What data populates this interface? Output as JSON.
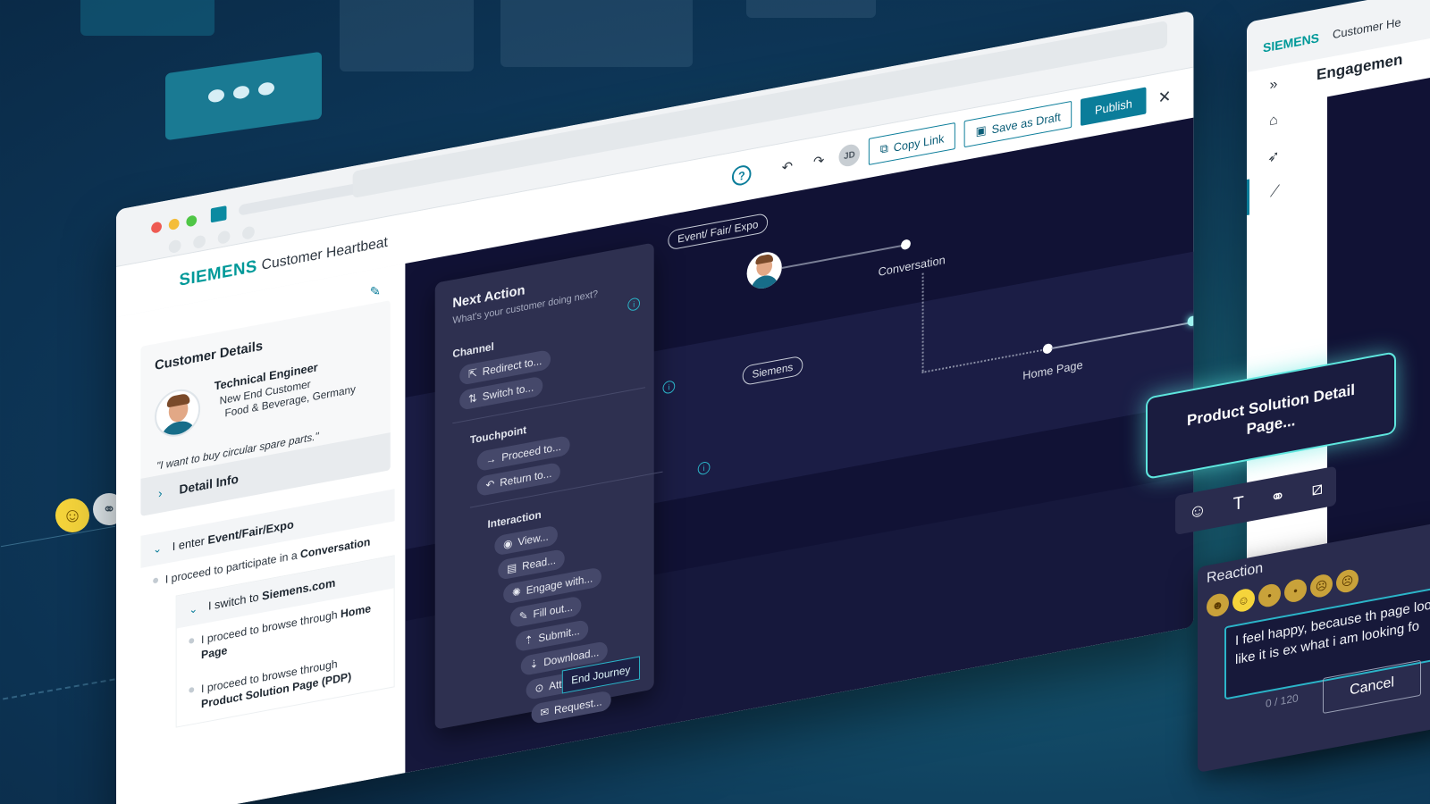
{
  "app": {
    "logo": "SIEMENS",
    "title": "Customer Heartbeat"
  },
  "header": {
    "user_initials": "JD",
    "copy_link": "Copy Link",
    "save_draft": "Save as Draft",
    "publish": "Publish"
  },
  "customer": {
    "section_title": "Customer Details",
    "role": "Technical Engineer",
    "segment": "New End Customer",
    "industry": "Food & Beverage, Germany",
    "quote": "\"I want to buy circular spare parts.\"",
    "detail_info": "Detail Info"
  },
  "journey_steps": {
    "step1_header_prefix": "I enter ",
    "step1_header_bold": "Event/Fair/Expo",
    "step1_item_prefix": "I proceed to participate in a ",
    "step1_item_bold": "Conversation",
    "step2_header_prefix": "I switch to ",
    "step2_header_bold": "Siemens.com",
    "step2_item1_prefix": "I proceed to browse through ",
    "step2_item1_bold": "Home Page",
    "step2_item2_prefix": "I proceed to browse through ",
    "step2_item2_bold": "Product Solution Page (PDP)"
  },
  "next_action": {
    "title": "Next Action",
    "subtitle": "What's your customer doing next?",
    "channel_label": "Channel",
    "channel_chips": [
      "Redirect to...",
      "Switch to..."
    ],
    "touchpoint_label": "Touchpoint",
    "touchpoint_chips": [
      "Proceed to...",
      "Return to..."
    ],
    "interaction_label": "Interaction",
    "interaction_chips": [
      "View...",
      "Read...",
      "Engage with...",
      "Fill out...",
      "Submit...",
      "Download...",
      "Attend...",
      "Request..."
    ],
    "end_journey": "End Journey"
  },
  "canvas": {
    "lane1_tag": "Event/ Fair/ Expo",
    "lane2_tag": "Siemens",
    "node_conversation": "Conversation",
    "node_home": "Home Page"
  },
  "product_card": {
    "title": "Product Solution Detail Page..."
  },
  "reaction": {
    "title": "Reaction",
    "text": "I feel happy, because th page looks like it is ex what i am looking fo",
    "counter": "0 / 120",
    "cancel": "Cancel"
  },
  "right_window": {
    "logo": "SIEMENS",
    "title": "Customer He",
    "heading": "Engagemen"
  },
  "colors": {
    "brand": "#009999",
    "accent": "#0b7d9a",
    "canvas": "#111235",
    "glow": "#5ee6de"
  },
  "icons": [
    "help-icon",
    "undo-icon",
    "redo-icon",
    "copy-icon",
    "save-icon",
    "close-icon",
    "edit-icon",
    "chevron-right-icon",
    "chevron-down-icon",
    "info-icon",
    "emoji-icon",
    "text-icon",
    "link-icon",
    "crop-icon",
    "home-icon",
    "rocket-icon",
    "chart-icon",
    "expand-icon"
  ]
}
